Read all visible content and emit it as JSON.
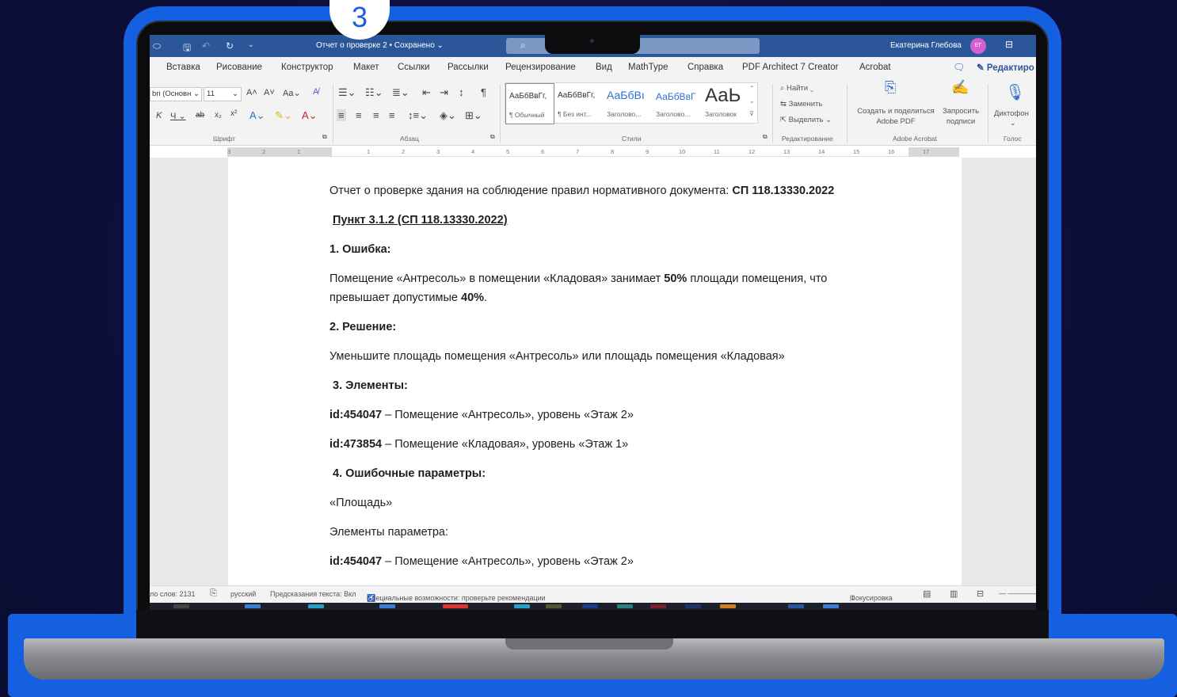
{
  "step": {
    "number": "3"
  },
  "titlebar": {
    "doc_title": "Отчет о проверке 2 • Сохранено ⌄",
    "user_name": "Екатерина Глебова",
    "avatar_initials": "ЕГ"
  },
  "menu": {
    "tabs": [
      "Вставка",
      "Рисование",
      "Конструктор",
      "Макет",
      "Ссылки",
      "Рассылки",
      "Рецензирование",
      "Вид",
      "MathType",
      "Справка",
      "PDF Architect 7 Creator",
      "Acrobat"
    ],
    "edit_label": "Редактиро"
  },
  "ribbon": {
    "font_name": "bri (Основн ⌄",
    "font_size": "11",
    "group_font": "Шрифт",
    "group_paragraph": "Абзац",
    "group_styles": "Стили",
    "group_editing": "Редактирование",
    "group_adobe": "Adobe Acrobat",
    "group_voice": "Голос",
    "styles": [
      {
        "sample": "АаБбВвГг,",
        "name": "¶ Обычный"
      },
      {
        "sample": "АаБбВвГг,",
        "name": "¶ Без инт..."
      },
      {
        "sample": "АаБбВı",
        "name": "Заголово..."
      },
      {
        "sample": "АаБбВвГ",
        "name": "Заголово..."
      },
      {
        "sample": "АаЬ",
        "name": "Заголовок"
      }
    ],
    "find": "Найти",
    "replace": "Заменить",
    "select": "Выделить",
    "create_share": "Создать и поделиться",
    "adobe_pdf": "Adobe PDF",
    "request": "Запросить",
    "signatures": "подписи",
    "dictate": "Диктофон"
  },
  "ruler": {
    "ticks": [
      "3",
      "2",
      "1",
      "1",
      "2",
      "3",
      "4",
      "5",
      "6",
      "7",
      "8",
      "9",
      "10",
      "11",
      "12",
      "13",
      "14",
      "15",
      "16",
      "17"
    ]
  },
  "document": {
    "heading_prefix": "Отчет о проверке здания на соблюдение правил нормативного документа: ",
    "heading_code": "СП 118.13330.2022",
    "clause": "Пункт 3.1.2 (СП 118.13330.2022)",
    "s1_title": "1. Ошибка:",
    "s1_text_a": "Помещение «Антресоль» в помещении «Кладовая» занимает ",
    "s1_text_b": "50%",
    "s1_text_c": " площади помещения, что",
    "s1_text_d": "превышает допустимые ",
    "s1_text_e": "40%",
    "s1_text_f": ".",
    "s2_title": "2. Решение:",
    "s2_text": "Уменьшите площадь помещения «Антресоль» или площадь помещения «Кладовая»",
    "s3_title": "3. Элементы:",
    "el1_id": "id:454047",
    "el1_text": " – Помещение «Антресоль», уровень «Этаж 2»",
    "el2_id": "id:473854",
    "el2_text": " – Помещение «Кладовая», уровень «Этаж 1»",
    "s4_title": "4. Ошибочные параметры:",
    "param": "«Площадь»",
    "param_elements": "Элементы параметра:",
    "el3_id": "id:454047",
    "el3_text": " – Помещение «Антресоль», уровень «Этаж 2»"
  },
  "status": {
    "words": "ло слов: 2131",
    "language": "русский",
    "prediction": "Предсказания текста: Вкл",
    "accessibility": "Специальные возможности: проверьте рекомендации",
    "focus": "Фокусировка"
  },
  "colors": {
    "frame_blue": "#1560e0",
    "word_blue": "#2b579a",
    "background": "#0e1140"
  }
}
